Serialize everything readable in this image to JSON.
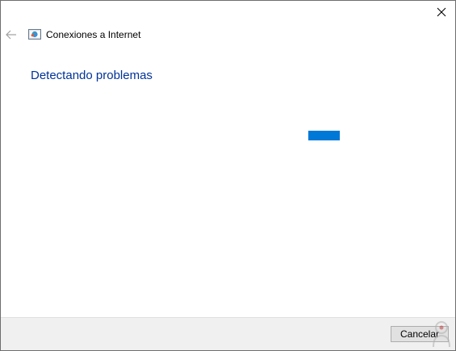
{
  "window": {
    "close_icon": "close-icon",
    "back_icon": "back-arrow-icon",
    "app_icon": "internet-connections-icon",
    "title": "Conexiones a Internet"
  },
  "main": {
    "heading": "Detectando problemas",
    "progress": {
      "style": "indeterminate",
      "color": "#0078d7"
    }
  },
  "footer": {
    "cancel_label": "Cancelar"
  },
  "colors": {
    "heading": "#003399",
    "accent": "#0078d7",
    "footer_bg": "#f0f0f0"
  }
}
